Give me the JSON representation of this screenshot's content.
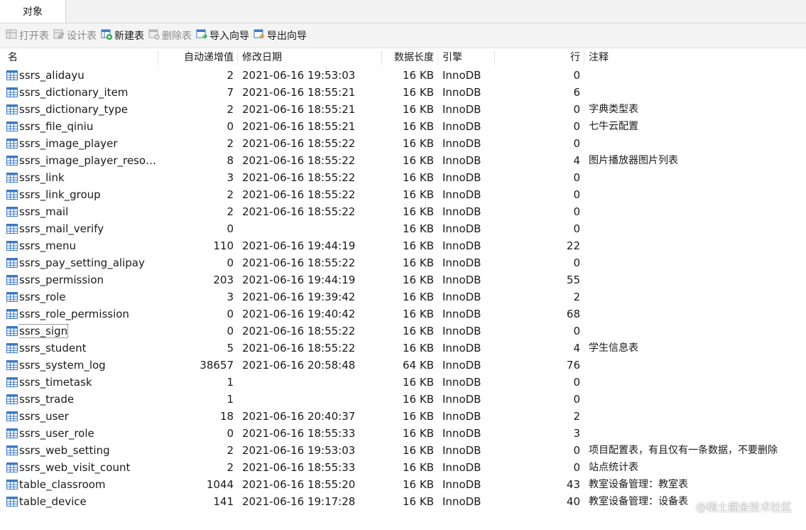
{
  "tabs": {
    "active_label": "对象"
  },
  "toolbar": {
    "buttons": [
      {
        "label": "打开表",
        "icon": "open-table-icon",
        "enabled": false
      },
      {
        "label": "设计表",
        "icon": "design-table-icon",
        "enabled": false
      },
      {
        "label": "新建表",
        "icon": "new-table-icon",
        "enabled": true
      },
      {
        "label": "删除表",
        "icon": "delete-table-icon",
        "enabled": false
      },
      {
        "label": "导入向导",
        "icon": "import-wizard-icon",
        "enabled": true
      },
      {
        "label": "导出向导",
        "icon": "export-wizard-icon",
        "enabled": true
      }
    ]
  },
  "columns": {
    "name": "名",
    "auto_increment": "自动递增值",
    "modified": "修改日期",
    "data_length": "数据长度",
    "engine": "引擎",
    "rows": "行",
    "comment": "注释"
  },
  "table_rows": [
    {
      "name": "ssrs_alidayu",
      "auto": "2",
      "date": "2021-06-16 19:53:03",
      "size": "16 KB",
      "engine": "InnoDB",
      "rows": "0",
      "comment": ""
    },
    {
      "name": "ssrs_dictionary_item",
      "auto": "7",
      "date": "2021-06-16 18:55:21",
      "size": "16 KB",
      "engine": "InnoDB",
      "rows": "6",
      "comment": ""
    },
    {
      "name": "ssrs_dictionary_type",
      "auto": "2",
      "date": "2021-06-16 18:55:21",
      "size": "16 KB",
      "engine": "InnoDB",
      "rows": "0",
      "comment": "字典类型表"
    },
    {
      "name": "ssrs_file_qiniu",
      "auto": "0",
      "date": "2021-06-16 18:55:21",
      "size": "16 KB",
      "engine": "InnoDB",
      "rows": "0",
      "comment": "七牛云配置"
    },
    {
      "name": "ssrs_image_player",
      "auto": "2",
      "date": "2021-06-16 18:55:22",
      "size": "16 KB",
      "engine": "InnoDB",
      "rows": "0",
      "comment": ""
    },
    {
      "name": "ssrs_image_player_resou...",
      "auto": "8",
      "date": "2021-06-16 18:55:22",
      "size": "16 KB",
      "engine": "InnoDB",
      "rows": "4",
      "comment": "图片播放器图片列表"
    },
    {
      "name": "ssrs_link",
      "auto": "3",
      "date": "2021-06-16 18:55:22",
      "size": "16 KB",
      "engine": "InnoDB",
      "rows": "0",
      "comment": ""
    },
    {
      "name": "ssrs_link_group",
      "auto": "2",
      "date": "2021-06-16 18:55:22",
      "size": "16 KB",
      "engine": "InnoDB",
      "rows": "0",
      "comment": ""
    },
    {
      "name": "ssrs_mail",
      "auto": "2",
      "date": "2021-06-16 18:55:22",
      "size": "16 KB",
      "engine": "InnoDB",
      "rows": "0",
      "comment": ""
    },
    {
      "name": "ssrs_mail_verify",
      "auto": "0",
      "date": "",
      "size": "16 KB",
      "engine": "InnoDB",
      "rows": "0",
      "comment": ""
    },
    {
      "name": "ssrs_menu",
      "auto": "110",
      "date": "2021-06-16 19:44:19",
      "size": "16 KB",
      "engine": "InnoDB",
      "rows": "22",
      "comment": ""
    },
    {
      "name": "ssrs_pay_setting_alipay",
      "auto": "0",
      "date": "2021-06-16 18:55:22",
      "size": "16 KB",
      "engine": "InnoDB",
      "rows": "0",
      "comment": ""
    },
    {
      "name": "ssrs_permission",
      "auto": "203",
      "date": "2021-06-16 19:44:19",
      "size": "16 KB",
      "engine": "InnoDB",
      "rows": "55",
      "comment": ""
    },
    {
      "name": "ssrs_role",
      "auto": "3",
      "date": "2021-06-16 19:39:42",
      "size": "16 KB",
      "engine": "InnoDB",
      "rows": "2",
      "comment": ""
    },
    {
      "name": "ssrs_role_permission",
      "auto": "0",
      "date": "2021-06-16 19:40:42",
      "size": "16 KB",
      "engine": "InnoDB",
      "rows": "68",
      "comment": ""
    },
    {
      "name": "ssrs_sign",
      "auto": "0",
      "date": "2021-06-16 18:55:22",
      "size": "16 KB",
      "engine": "InnoDB",
      "rows": "0",
      "comment": "",
      "focused": true
    },
    {
      "name": "ssrs_student",
      "auto": "5",
      "date": "2021-06-16 18:55:22",
      "size": "16 KB",
      "engine": "InnoDB",
      "rows": "4",
      "comment": "学生信息表"
    },
    {
      "name": "ssrs_system_log",
      "auto": "38657",
      "date": "2021-06-16 20:58:48",
      "size": "64 KB",
      "engine": "InnoDB",
      "rows": "76",
      "comment": ""
    },
    {
      "name": "ssrs_timetask",
      "auto": "1",
      "date": "",
      "size": "16 KB",
      "engine": "InnoDB",
      "rows": "0",
      "comment": ""
    },
    {
      "name": "ssrs_trade",
      "auto": "1",
      "date": "",
      "size": "16 KB",
      "engine": "InnoDB",
      "rows": "0",
      "comment": ""
    },
    {
      "name": "ssrs_user",
      "auto": "18",
      "date": "2021-06-16 20:40:37",
      "size": "16 KB",
      "engine": "InnoDB",
      "rows": "2",
      "comment": ""
    },
    {
      "name": "ssrs_user_role",
      "auto": "0",
      "date": "2021-06-16 18:55:33",
      "size": "16 KB",
      "engine": "InnoDB",
      "rows": "3",
      "comment": ""
    },
    {
      "name": "ssrs_web_setting",
      "auto": "2",
      "date": "2021-06-16 19:53:03",
      "size": "16 KB",
      "engine": "InnoDB",
      "rows": "0",
      "comment": "项目配置表，有且仅有一条数据，不要删除"
    },
    {
      "name": "ssrs_web_visit_count",
      "auto": "2",
      "date": "2021-06-16 18:55:33",
      "size": "16 KB",
      "engine": "InnoDB",
      "rows": "0",
      "comment": "站点统计表"
    },
    {
      "name": "table_classroom",
      "auto": "1044",
      "date": "2021-06-16 18:55:20",
      "size": "16 KB",
      "engine": "InnoDB",
      "rows": "43",
      "comment": "教室设备管理：教室表"
    },
    {
      "name": "table_device",
      "auto": "141",
      "date": "2021-06-16 19:17:28",
      "size": "16 KB",
      "engine": "InnoDB",
      "rows": "40",
      "comment": "教室设备管理：设备表"
    }
  ],
  "watermark": "@稀土掘金技术社区",
  "colors": {
    "table_icon": "#3a78c8",
    "add_badge": "#2fa84f",
    "disabled_text": "#8a8a8a"
  }
}
